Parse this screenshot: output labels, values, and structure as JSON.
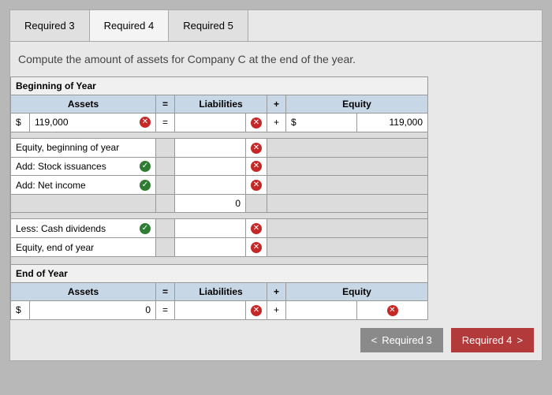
{
  "tabs": {
    "t3": "Required 3",
    "t4": "Required 4",
    "t5": "Required 5"
  },
  "instruction": "Compute the amount of assets for Company C at the end of the year.",
  "sections": {
    "beginning": "Beginning of Year",
    "end": "End of Year"
  },
  "headers": {
    "assets": "Assets",
    "liabilities": "Liabilities",
    "equity": "Equity",
    "eq": "=",
    "plus": "+"
  },
  "row_assets_begin": {
    "currency": "$",
    "value": "119,000",
    "eq": "="
  },
  "row_equity_begin": {
    "currency": "$",
    "value": "119,000",
    "plus": "+"
  },
  "labels": {
    "eq_begin": "Equity, beginning of year",
    "stock": "Add: Stock issuances",
    "netincome": "Add: Net income",
    "subtotal": "0",
    "dividends": "Less: Cash dividends",
    "eq_end": "Equity, end of year"
  },
  "row_assets_end": {
    "currency": "$",
    "value": "0",
    "eq": "="
  },
  "row_equity_end": {
    "plus": "+"
  },
  "nav": {
    "prev": "Required 3",
    "next": "Required 4"
  }
}
